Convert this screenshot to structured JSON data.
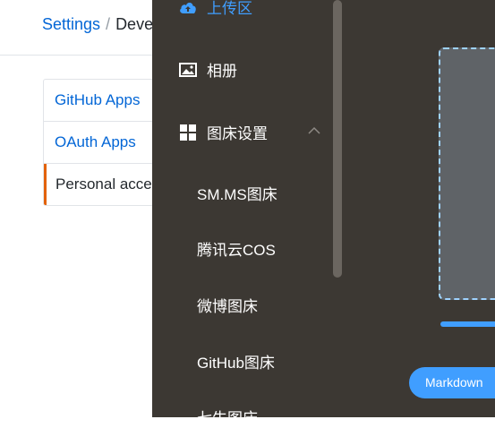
{
  "github": {
    "breadcrumb": {
      "settings": "Settings",
      "separator": "/",
      "developer": "Deve"
    },
    "menu": [
      "GitHub Apps",
      "OAuth Apps",
      "Personal acces"
    ]
  },
  "app": {
    "nav": {
      "upload": "上传区",
      "gallery": "相册",
      "picbed_settings": "图床设置",
      "sub": [
        "SM.MS图床",
        "腾讯云COS",
        "微博图床",
        "GitHub图床",
        "七牛图床"
      ]
    },
    "main": {
      "markdown_button": "Markdown"
    },
    "colors": {
      "accent": "#409eff",
      "sidebar_bg": "#3c3833",
      "upload_border": "#9fd3ff",
      "gh_link": "#0366d6",
      "gh_selected": "#e36209"
    }
  }
}
